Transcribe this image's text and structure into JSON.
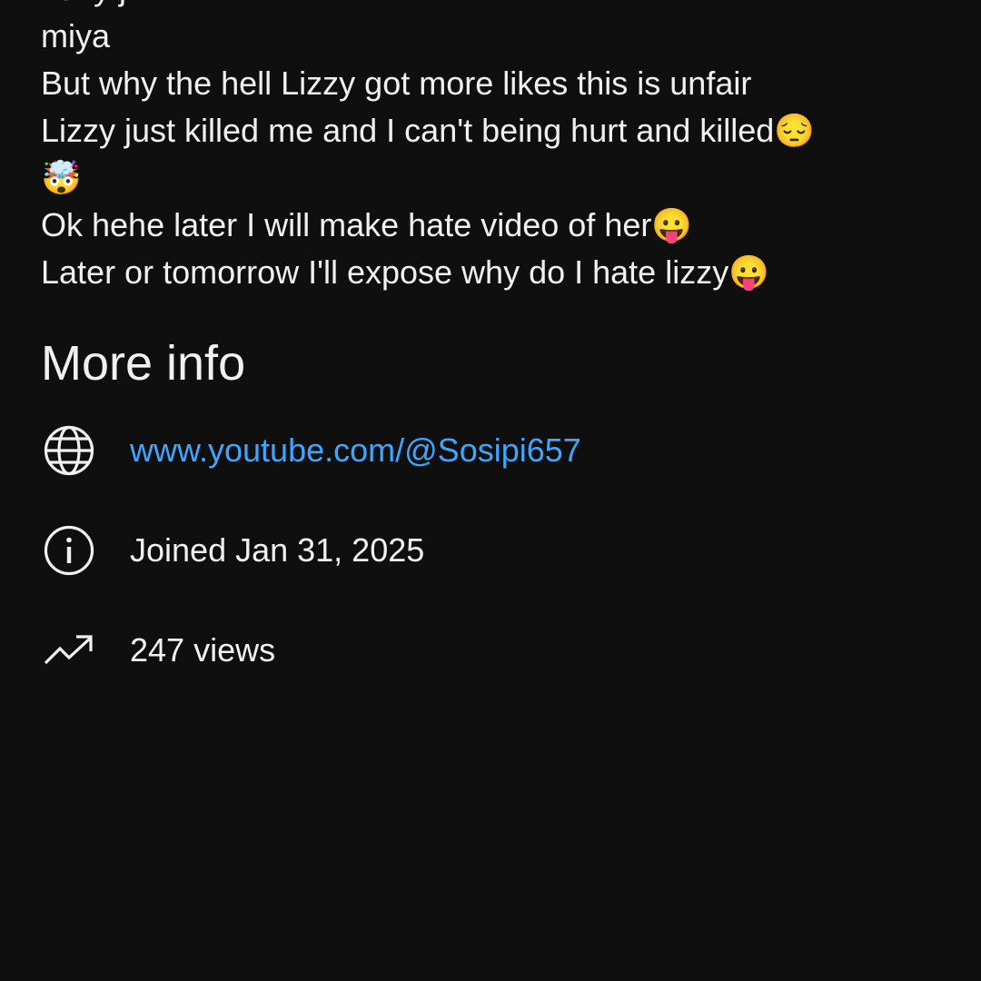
{
  "description": {
    "lines": [
      "Lazy j",
      "miya",
      "But why the hell Lizzy got more likes this is unfair",
      "Lizzy just killed me and I can't being hurt and killed😔",
      "🤯",
      "Ok hehe later I will make hate video of her😛",
      "Later or tomorrow I'll expose why do I hate lizzy😛"
    ]
  },
  "more_info": {
    "title": "More info",
    "link": "www.youtube.com/@Sosipi657",
    "joined": "Joined Jan 31, 2025",
    "views": "247 views",
    "icons": [
      "globe-icon",
      "info-icon",
      "trending-icon"
    ]
  },
  "colors": {
    "background": "#0f0f0f",
    "text": "#f1f1f1",
    "link": "#3ea6ff"
  }
}
